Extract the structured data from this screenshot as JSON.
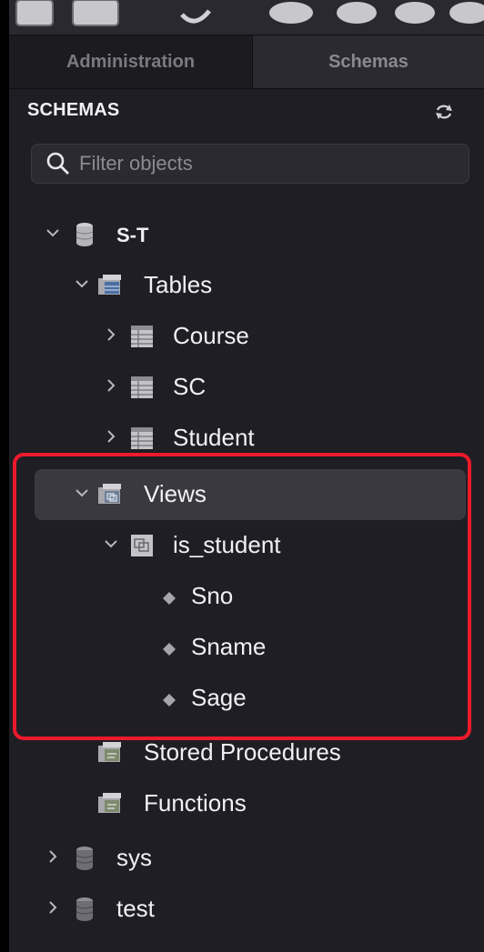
{
  "tabs": {
    "administration": "Administration",
    "schemas": "Schemas"
  },
  "sidebar": {
    "header": "SCHEMAS",
    "filter_placeholder": "Filter objects"
  },
  "tree": {
    "schema_st": "S-T",
    "tables": "Tables",
    "table_course": "Course",
    "table_sc": "SC",
    "table_student": "Student",
    "views": "Views",
    "view_is_student": "is_student",
    "col_sno": "Sno",
    "col_sname": "Sname",
    "col_sage": "Sage",
    "stored_procedures": "Stored Procedures",
    "functions": "Functions",
    "schema_sys": "sys",
    "schema_test": "test"
  },
  "colors": {
    "background": "#1f1e24",
    "selected_row": "#3a393f",
    "highlight_border": "#ee1a2c"
  },
  "icons": {
    "refresh": "refresh-icon",
    "search": "search-icon",
    "database": "database-icon",
    "folder": "folder-icon",
    "table": "table-icon",
    "view": "view-icon",
    "column": "column-diamond-icon"
  }
}
